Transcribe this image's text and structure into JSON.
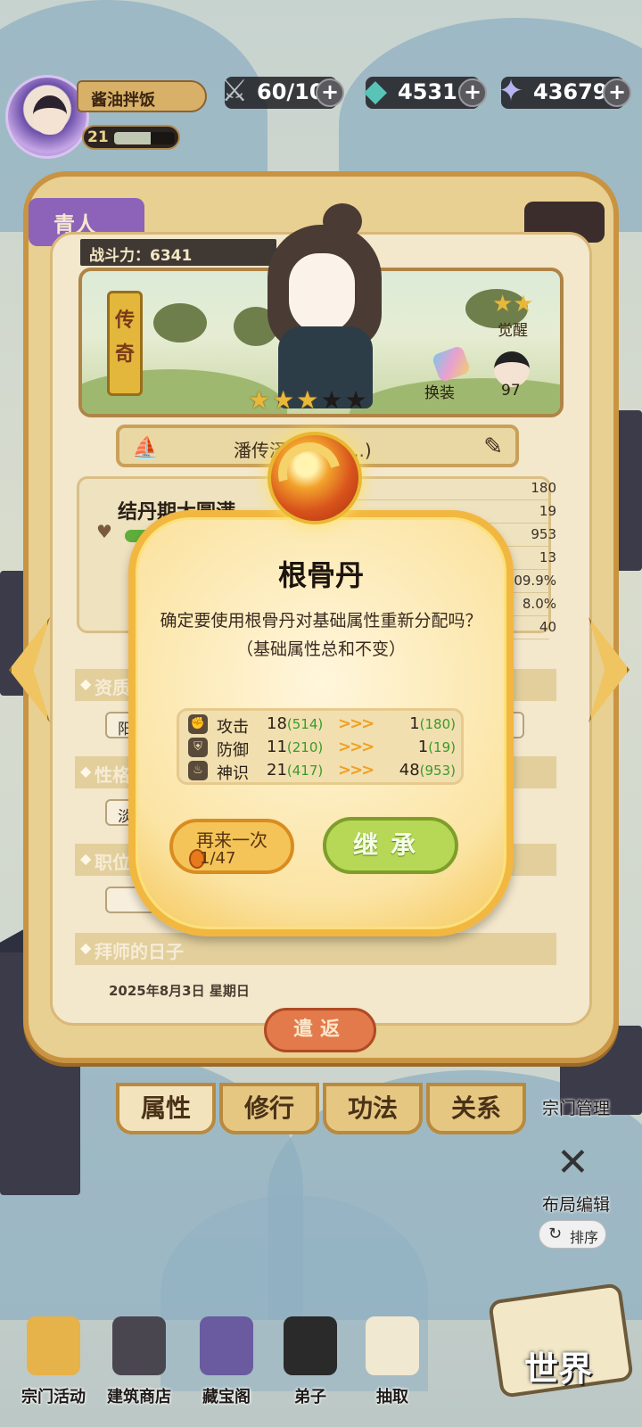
{
  "player": {
    "name": "酱油拌饭",
    "level": "21",
    "exp_fraction": 0.6
  },
  "resources": [
    {
      "icon": "sword-icon",
      "value": "60/100",
      "glyph": "⚔"
    },
    {
      "icon": "jade-icon",
      "value": "45316",
      "glyph": "◆"
    },
    {
      "icon": "crystal-icon",
      "value": "43679",
      "glyph": "✦"
    }
  ],
  "panel": {
    "top_tab": "青人",
    "power": "战斗力：6341",
    "rarity": "传\n奇",
    "stars": {
      "filled": 3,
      "total": 5
    },
    "awaken": "觉醒",
    "outfit": "换装",
    "disciple_count": "97",
    "name_status": "潘传泽(闭关中...)",
    "realm": "结丹期大圆满",
    "stat_values": [
      "180",
      "19",
      "953",
      "13",
      "09.9%",
      "8.0%",
      "40"
    ],
    "sections": [
      {
        "label": "资质",
        "chip": "阳"
      },
      {
        "label": "性格",
        "chip": "淡"
      },
      {
        "label": "职位",
        "chip": "无"
      },
      {
        "label": "拜师的日子",
        "chip": ""
      }
    ],
    "date": "2025年8月3日 星期日",
    "dismiss": "遣返",
    "tabs": [
      "属性",
      "修行",
      "功法",
      "关系"
    ]
  },
  "modal": {
    "title": "根骨丹",
    "description": "确定要使用根骨丹对基础属性重新分配吗？（基础属性总和不变）",
    "rows": [
      {
        "icon": "fist-icon",
        "glyph": "✊",
        "label": "攻击",
        "before": "18",
        "before_total": "(514)",
        "after": "1",
        "after_total": "(180)"
      },
      {
        "icon": "shield-icon",
        "glyph": "⛨",
        "label": "防御",
        "before": "11",
        "before_total": "(210)",
        "after": "1",
        "after_total": "(19)"
      },
      {
        "icon": "flame-icon",
        "glyph": "♨",
        "label": "神识",
        "before": "21",
        "before_total": "(417)",
        "after": "48",
        "after_total": "(953)"
      }
    ],
    "arrows": ">>>",
    "retry_label": "再来一次",
    "retry_count": "1/47",
    "confirm_label": "继承"
  },
  "side": {
    "manage": "宗门管理",
    "layout": "布局编辑",
    "sort": "排序"
  },
  "nav": [
    {
      "label": "宗门活动",
      "color": "#e6b24a"
    },
    {
      "label": "建筑商店",
      "color": "#4a4650"
    },
    {
      "label": "藏宝阁",
      "color": "#6a5aa0"
    },
    {
      "label": "弟子",
      "color": "#2a2a2a"
    },
    {
      "label": "抽取",
      "color": "#f0e8d0"
    }
  ],
  "world_label": "世界"
}
